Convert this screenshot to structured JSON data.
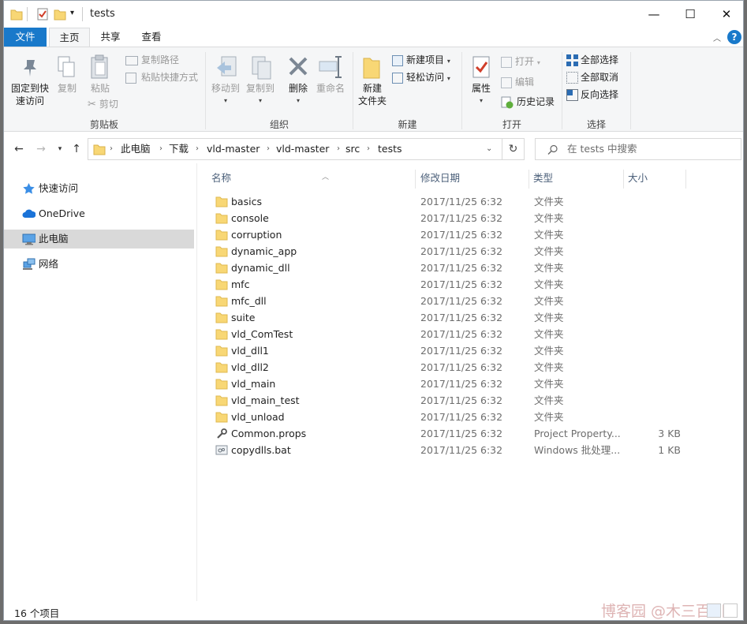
{
  "window": {
    "title": "tests",
    "minimize": "—",
    "maximize": "☐",
    "close": "✕"
  },
  "ribbon_tabs": [
    {
      "label": "文件"
    },
    {
      "label": "主页"
    },
    {
      "label": "共享"
    },
    {
      "label": "查看"
    }
  ],
  "ribbon": {
    "clipboard": {
      "pin": "固定到快速访问",
      "pin_line1": "固定到快",
      "pin_line2": "速访问",
      "copy": "复制",
      "paste": "粘贴",
      "copy_path": "复制路径",
      "paste_shortcut": "粘贴快捷方式",
      "cut": "剪切",
      "group_label": "剪贴板"
    },
    "organize": {
      "move_to": "移动到",
      "copy_to": "复制到",
      "delete": "删除",
      "rename": "重命名",
      "group_label": "组织"
    },
    "new": {
      "new_folder_line1": "新建",
      "new_folder_line2": "文件夹",
      "new_item": "新建项目",
      "easy_access": "轻松访问",
      "group_label": "新建"
    },
    "open": {
      "properties": "属性",
      "open": "打开",
      "edit": "编辑",
      "history": "历史记录",
      "group_label": "打开"
    },
    "select": {
      "select_all": "全部选择",
      "select_none": "全部取消",
      "invert": "反向选择",
      "group_label": "选择"
    }
  },
  "address": {
    "breadcrumbs": [
      "此电脑",
      "下载",
      "vld-master",
      "vld-master",
      "src",
      "tests"
    ],
    "search_placeholder": "在 tests 中搜索"
  },
  "nav_pane": [
    {
      "label": "快速访问",
      "icon": "star-icon"
    },
    {
      "label": "OneDrive",
      "icon": "cloud-icon"
    },
    {
      "label": "此电脑",
      "icon": "computer-icon",
      "selected": true
    },
    {
      "label": "网络",
      "icon": "network-icon"
    }
  ],
  "columns": {
    "name": "名称",
    "date": "修改日期",
    "type": "类型",
    "size": "大小"
  },
  "files": [
    {
      "name": "basics",
      "date": "2017/11/25 6:32",
      "type": "文件夹",
      "size": "",
      "icon": "folder-icon"
    },
    {
      "name": "console",
      "date": "2017/11/25 6:32",
      "type": "文件夹",
      "size": "",
      "icon": "folder-icon"
    },
    {
      "name": "corruption",
      "date": "2017/11/25 6:32",
      "type": "文件夹",
      "size": "",
      "icon": "folder-icon"
    },
    {
      "name": "dynamic_app",
      "date": "2017/11/25 6:32",
      "type": "文件夹",
      "size": "",
      "icon": "folder-icon"
    },
    {
      "name": "dynamic_dll",
      "date": "2017/11/25 6:32",
      "type": "文件夹",
      "size": "",
      "icon": "folder-icon"
    },
    {
      "name": "mfc",
      "date": "2017/11/25 6:32",
      "type": "文件夹",
      "size": "",
      "icon": "folder-icon"
    },
    {
      "name": "mfc_dll",
      "date": "2017/11/25 6:32",
      "type": "文件夹",
      "size": "",
      "icon": "folder-icon"
    },
    {
      "name": "suite",
      "date": "2017/11/25 6:32",
      "type": "文件夹",
      "size": "",
      "icon": "folder-icon"
    },
    {
      "name": "vld_ComTest",
      "date": "2017/11/25 6:32",
      "type": "文件夹",
      "size": "",
      "icon": "folder-icon"
    },
    {
      "name": "vld_dll1",
      "date": "2017/11/25 6:32",
      "type": "文件夹",
      "size": "",
      "icon": "folder-icon"
    },
    {
      "name": "vld_dll2",
      "date": "2017/11/25 6:32",
      "type": "文件夹",
      "size": "",
      "icon": "folder-icon"
    },
    {
      "name": "vld_main",
      "date": "2017/11/25 6:32",
      "type": "文件夹",
      "size": "",
      "icon": "folder-icon"
    },
    {
      "name": "vld_main_test",
      "date": "2017/11/25 6:32",
      "type": "文件夹",
      "size": "",
      "icon": "folder-icon"
    },
    {
      "name": "vld_unload",
      "date": "2017/11/25 6:32",
      "type": "文件夹",
      "size": "",
      "icon": "folder-icon"
    },
    {
      "name": "Common.props",
      "date": "2017/11/25 6:32",
      "type": "Project Property...",
      "size": "3 KB",
      "icon": "wrench-icon"
    },
    {
      "name": "copydlls.bat",
      "date": "2017/11/25 6:32",
      "type": "Windows 批处理...",
      "size": "1 KB",
      "icon": "batch-file-icon"
    }
  ],
  "status": {
    "item_count": "16 个项目"
  },
  "watermark": "博客园 @木三百川",
  "colors": {
    "accent": "#1979ca",
    "folder": "#f8d775",
    "selection": "#d9d9d9"
  }
}
